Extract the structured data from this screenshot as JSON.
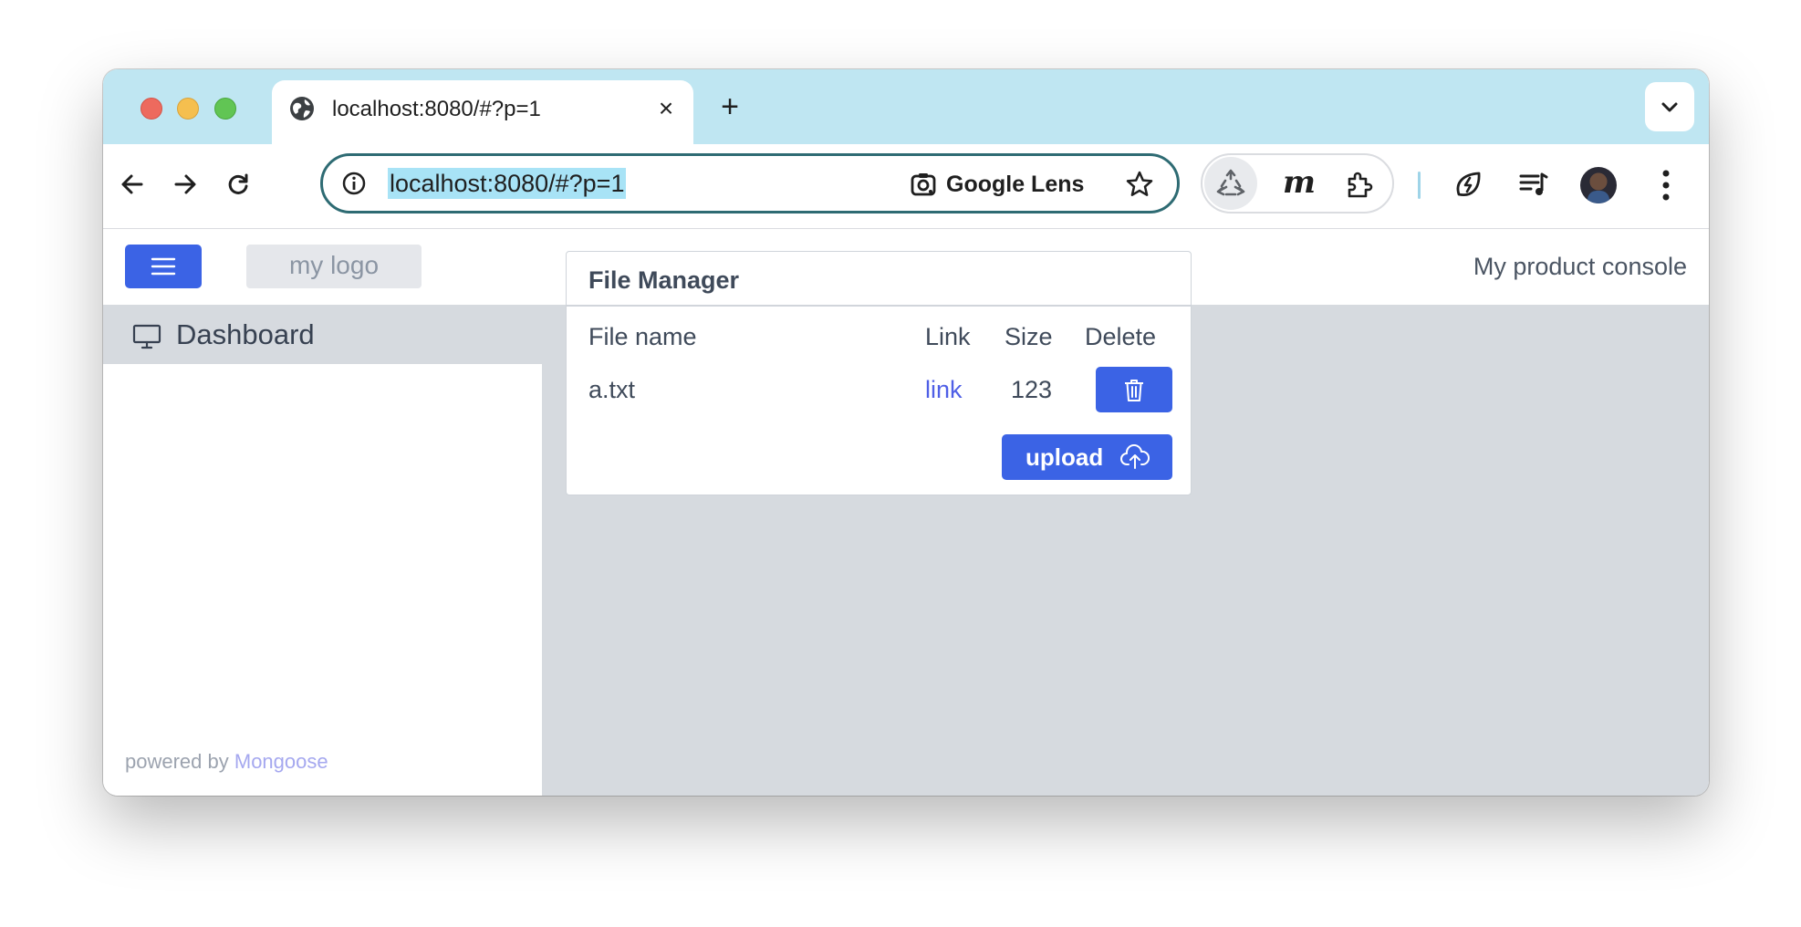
{
  "browser": {
    "tab_title": "localhost:8080/#?p=1",
    "url": "localhost:8080/#?p=1",
    "lens_label": "Google Lens",
    "extension_m": "m"
  },
  "app": {
    "logo_text": "my logo",
    "product_title": "My product console",
    "sidebar": {
      "items": [
        {
          "label": "Dashboard",
          "icon": "monitor-icon"
        }
      ],
      "powered_prefix": "powered by",
      "powered_brand": "Mongoose"
    },
    "file_manager": {
      "title": "File Manager",
      "columns": [
        "File name",
        "Link",
        "Size",
        "Delete"
      ],
      "rows": [
        {
          "name": "a.txt",
          "link": "link",
          "size": "123"
        }
      ],
      "upload_label": "upload"
    }
  },
  "colors": {
    "accent": "#3b63e5",
    "tabstrip": "#bfe6f2",
    "page_bg": "#d6dadf",
    "link": "#4f5fe6",
    "brand_link": "#a5a8ef"
  }
}
